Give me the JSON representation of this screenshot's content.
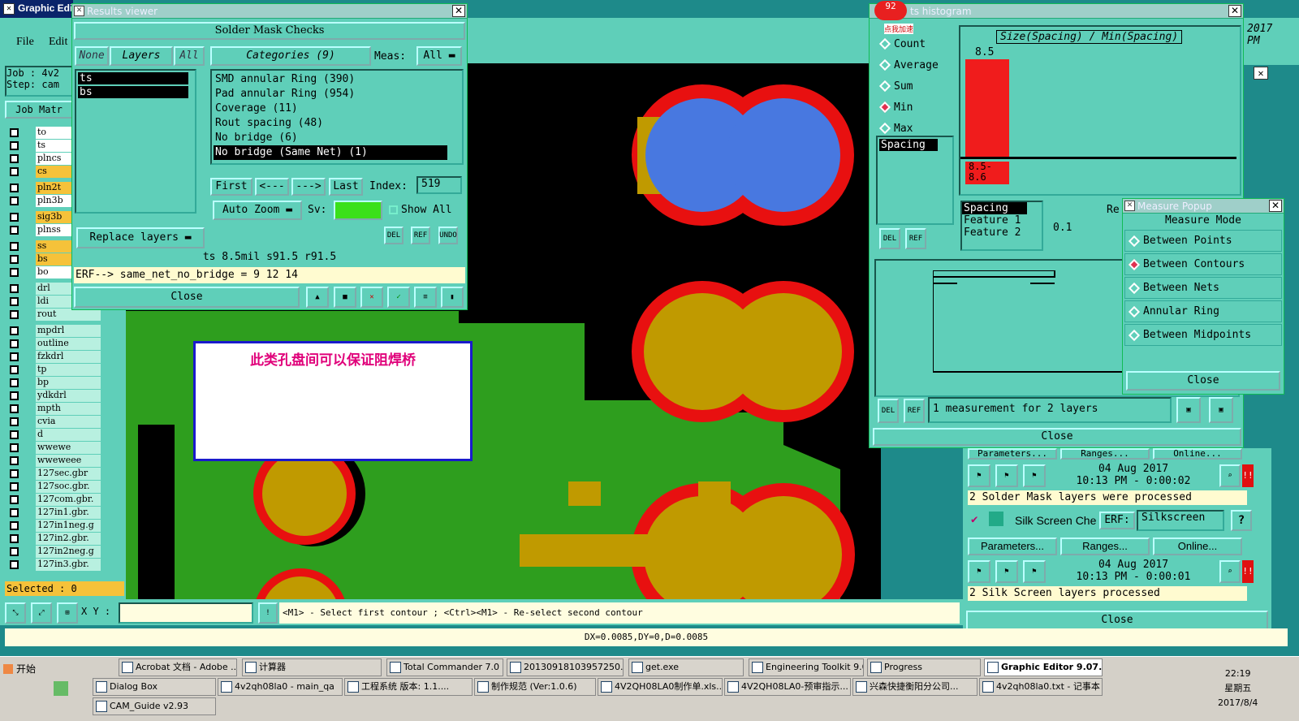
{
  "main_window": {
    "title": "Graphic Edi",
    "menu_file": "File",
    "menu_edit": "Edit",
    "job": "Job : 4v2",
    "step": "Step: cam",
    "job_matrix": "Job Matr",
    "selected": "Selected : 0",
    "xy_label": "X Y :",
    "xy_value": "",
    "status_hint": "<M1> - Select first contour ; <Ctrl><M1> - Re-select second contour",
    "delta": "DX=0.0085,DY=0,D=0.0085"
  },
  "layers": [
    "to",
    "ts",
    "plncs",
    "cs",
    "pln2t",
    "pln3b",
    "sig3b",
    "plnss",
    "ss",
    "bs",
    "bo",
    "drl",
    "ldi",
    "rout",
    "mpdrl",
    "outline",
    "fzkdrl",
    "tp",
    "bp",
    "ydkdrl",
    "mpth",
    "cvia",
    "d",
    "wwewe",
    "wweweee",
    "127sec.gbr",
    "127soc.gbr.",
    "127com.gbr.",
    "127in1.gbr.",
    "127in1neg.g",
    "127in2.gbr.",
    "127in2neg.g",
    "127in3.gbr."
  ],
  "results": {
    "title": "Results viewer",
    "header": "Solder Mask Checks",
    "none": "None",
    "layers": "Layers",
    "all": "All",
    "categories": "Categories (9)",
    "meas": "Meas:",
    "meas_value": "All",
    "layer_list": [
      "ts",
      "bs"
    ],
    "category_list": [
      "SMD annular Ring (390)",
      "Pad annular Ring (954)",
      "Coverage (11)",
      "Rout spacing (48)",
      "No bridge (6)",
      "No bridge (Same Net) (1)"
    ],
    "first": "First",
    "prev": "<---",
    "next": "--->",
    "last": "Last",
    "index_label": "Index:",
    "index_value": "519",
    "auto_zoom": "Auto Zoom",
    "sv": "Sv:",
    "show_all": "Show All",
    "replace_layers": "Replace layers",
    "info": "ts 8.5mil  s91.5  r91.5",
    "erf": "ERF--> same_net_no_bridge = 9 12 14",
    "close": "Close",
    "del": "DEL",
    "ref": "REF",
    "undo": "UNDO"
  },
  "annotation": {
    "text": "此类孔盘间可以保证阻焊桥"
  },
  "histogram": {
    "title": "ts histogram",
    "stat_options": [
      "Count",
      "Average",
      "Sum",
      "Min",
      "Max"
    ],
    "selected": "Min",
    "chart_title": "Size(Spacing) / Min(Spacing)",
    "bar_value": "8.5",
    "bar_label": "8.5-\n8.6",
    "spacing": "Spacing",
    "list": [
      "Spacing",
      "Feature 1",
      "Feature 2"
    ],
    "re": "Re",
    "val": "0.1",
    "measurement": "1 measurement for 2 layers",
    "close": "Close",
    "del": "DEL",
    "ref": "REF",
    "badge": "92",
    "badge_text": "点我加速"
  },
  "measure": {
    "title": "Measure Popup",
    "mode_header": "Measure Mode",
    "options": [
      "Between Points",
      "Between Contours",
      "Between Nets",
      "Annular Ring",
      "Between Midpoints"
    ],
    "selected": "Between Contours",
    "close": "Close"
  },
  "checklist": {
    "params": "Parameters...",
    "ranges": "Ranges...",
    "online": "Online...",
    "date1": "04 Aug 2017",
    "time1": "10:13 PM - 0:00:02",
    "msg1": "2 Solder Mask layers were processed",
    "silk_label": "Silk Screen Che",
    "erf": "ERF:",
    "erf_value": "Silkscreen",
    "help": "?",
    "date2": "04 Aug 2017",
    "time2": "10:13 PM - 0:00:01",
    "msg2": "2 Silk Screen layers processed",
    "close": "Close"
  },
  "right_edge": {
    "year": "2017",
    "pm": "PM"
  },
  "taskbar": {
    "start": "开始",
    "row1": [
      "Acrobat 文档 - Adobe ...",
      "计算器",
      "Total Commander 7.0 ...",
      "20130918103957250....",
      "get.exe",
      "Engineering Toolkit 9.0...",
      "Progress",
      "Graphic Editor 9.07..."
    ],
    "row2": [
      "Dialog Box",
      "4v2qh08la0 - main_qa",
      "工程系统  版本: 1.1....",
      "制作规范 (Ver:1.0.6)",
      "4V2QH08LA0制作单.xls...",
      "4V2QH08LA0-预审指示...",
      "兴森快捷衡阳分公司...",
      "4v2qh08la0.txt - 记事本"
    ],
    "row3": [
      "CAM_Guide v2.93"
    ],
    "clock": "22:19",
    "weekday": "星期五",
    "date": "2017/8/4"
  }
}
